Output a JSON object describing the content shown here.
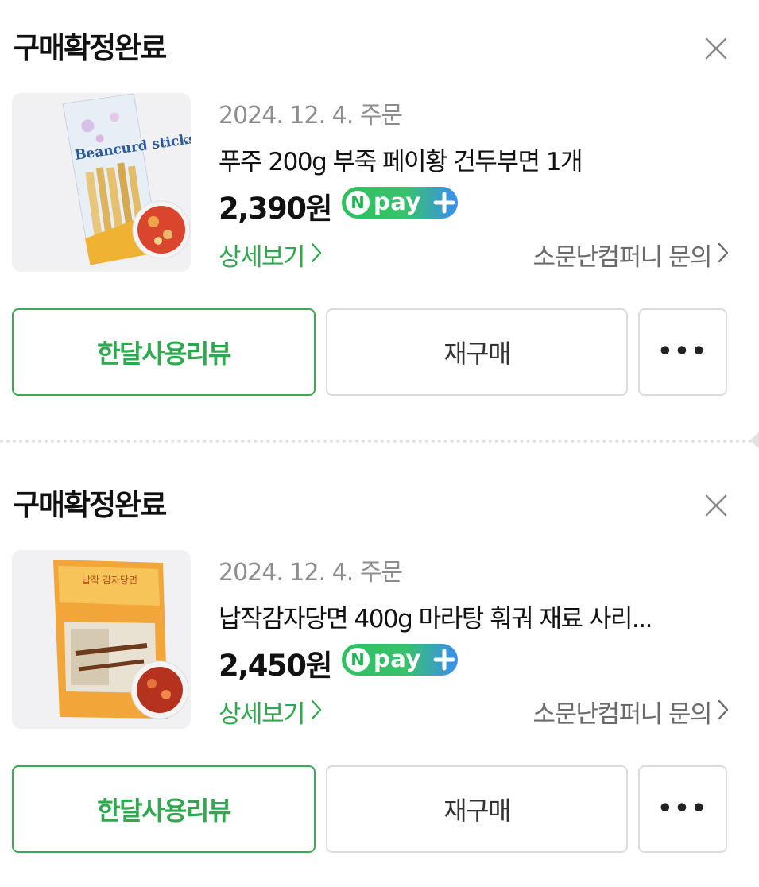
{
  "orders": [
    {
      "status": "구매확정완료",
      "date": "2024. 12. 4. 주문",
      "product_name": "푸주 200g 부죽 페이황 건두부면 1개",
      "price": "2,390원",
      "npay_badge": {
        "n": "N",
        "text": "pay",
        "icon": "plus-icon"
      },
      "detail_link": "상세보기",
      "store_inquiry": "소문난컴퍼니 문의",
      "buttons": {
        "review": "한달사용리뷰",
        "rebuy": "재구매",
        "more": "•••"
      },
      "product_image_text": "Beancurd sticks"
    },
    {
      "status": "구매확정완료",
      "date": "2024. 12. 4. 주문",
      "product_name": "납작감자당면 400g 마라탕 훠궈 재료 사리...",
      "price": "2,450원",
      "npay_badge": {
        "n": "N",
        "text": "pay",
        "icon": "plus-icon"
      },
      "detail_link": "상세보기",
      "store_inquiry": "소문난컴퍼니 문의",
      "buttons": {
        "review": "한달사용리뷰",
        "rebuy": "재구매",
        "more": "•••"
      },
      "product_image_text": "납작 감자당면"
    }
  ],
  "colors": {
    "accent_green": "#2fa84f",
    "npay_green": "#2fc062",
    "npay_blue": "#3a8ef0",
    "muted_text": "#8d8d8d",
    "border": "#dcdcdc"
  }
}
